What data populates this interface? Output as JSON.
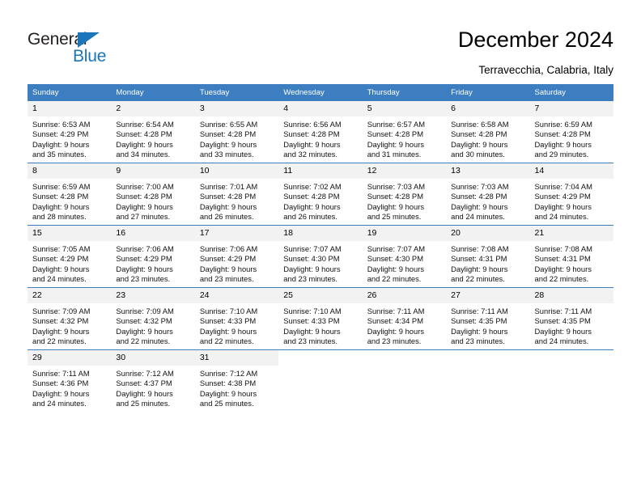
{
  "brand": {
    "name_part1": "General",
    "name_part2": "Blue",
    "accent_color": "#1b75bb"
  },
  "header": {
    "title": "December 2024",
    "subtitle": "Terravecchia, Calabria, Italy",
    "header_bg_color": "#3c7ebf",
    "daynum_bg_color": "#f2f2f2"
  },
  "weekdays": [
    "Sunday",
    "Monday",
    "Tuesday",
    "Wednesday",
    "Thursday",
    "Friday",
    "Saturday"
  ],
  "weeks": [
    [
      {
        "day": "1",
        "sunrise": "Sunrise: 6:53 AM",
        "sunset": "Sunset: 4:29 PM",
        "daylight1": "Daylight: 9 hours",
        "daylight2": "and 35 minutes."
      },
      {
        "day": "2",
        "sunrise": "Sunrise: 6:54 AM",
        "sunset": "Sunset: 4:28 PM",
        "daylight1": "Daylight: 9 hours",
        "daylight2": "and 34 minutes."
      },
      {
        "day": "3",
        "sunrise": "Sunrise: 6:55 AM",
        "sunset": "Sunset: 4:28 PM",
        "daylight1": "Daylight: 9 hours",
        "daylight2": "and 33 minutes."
      },
      {
        "day": "4",
        "sunrise": "Sunrise: 6:56 AM",
        "sunset": "Sunset: 4:28 PM",
        "daylight1": "Daylight: 9 hours",
        "daylight2": "and 32 minutes."
      },
      {
        "day": "5",
        "sunrise": "Sunrise: 6:57 AM",
        "sunset": "Sunset: 4:28 PM",
        "daylight1": "Daylight: 9 hours",
        "daylight2": "and 31 minutes."
      },
      {
        "day": "6",
        "sunrise": "Sunrise: 6:58 AM",
        "sunset": "Sunset: 4:28 PM",
        "daylight1": "Daylight: 9 hours",
        "daylight2": "and 30 minutes."
      },
      {
        "day": "7",
        "sunrise": "Sunrise: 6:59 AM",
        "sunset": "Sunset: 4:28 PM",
        "daylight1": "Daylight: 9 hours",
        "daylight2": "and 29 minutes."
      }
    ],
    [
      {
        "day": "8",
        "sunrise": "Sunrise: 6:59 AM",
        "sunset": "Sunset: 4:28 PM",
        "daylight1": "Daylight: 9 hours",
        "daylight2": "and 28 minutes."
      },
      {
        "day": "9",
        "sunrise": "Sunrise: 7:00 AM",
        "sunset": "Sunset: 4:28 PM",
        "daylight1": "Daylight: 9 hours",
        "daylight2": "and 27 minutes."
      },
      {
        "day": "10",
        "sunrise": "Sunrise: 7:01 AM",
        "sunset": "Sunset: 4:28 PM",
        "daylight1": "Daylight: 9 hours",
        "daylight2": "and 26 minutes."
      },
      {
        "day": "11",
        "sunrise": "Sunrise: 7:02 AM",
        "sunset": "Sunset: 4:28 PM",
        "daylight1": "Daylight: 9 hours",
        "daylight2": "and 26 minutes."
      },
      {
        "day": "12",
        "sunrise": "Sunrise: 7:03 AM",
        "sunset": "Sunset: 4:28 PM",
        "daylight1": "Daylight: 9 hours",
        "daylight2": "and 25 minutes."
      },
      {
        "day": "13",
        "sunrise": "Sunrise: 7:03 AM",
        "sunset": "Sunset: 4:28 PM",
        "daylight1": "Daylight: 9 hours",
        "daylight2": "and 24 minutes."
      },
      {
        "day": "14",
        "sunrise": "Sunrise: 7:04 AM",
        "sunset": "Sunset: 4:29 PM",
        "daylight1": "Daylight: 9 hours",
        "daylight2": "and 24 minutes."
      }
    ],
    [
      {
        "day": "15",
        "sunrise": "Sunrise: 7:05 AM",
        "sunset": "Sunset: 4:29 PM",
        "daylight1": "Daylight: 9 hours",
        "daylight2": "and 24 minutes."
      },
      {
        "day": "16",
        "sunrise": "Sunrise: 7:06 AM",
        "sunset": "Sunset: 4:29 PM",
        "daylight1": "Daylight: 9 hours",
        "daylight2": "and 23 minutes."
      },
      {
        "day": "17",
        "sunrise": "Sunrise: 7:06 AM",
        "sunset": "Sunset: 4:29 PM",
        "daylight1": "Daylight: 9 hours",
        "daylight2": "and 23 minutes."
      },
      {
        "day": "18",
        "sunrise": "Sunrise: 7:07 AM",
        "sunset": "Sunset: 4:30 PM",
        "daylight1": "Daylight: 9 hours",
        "daylight2": "and 23 minutes."
      },
      {
        "day": "19",
        "sunrise": "Sunrise: 7:07 AM",
        "sunset": "Sunset: 4:30 PM",
        "daylight1": "Daylight: 9 hours",
        "daylight2": "and 22 minutes."
      },
      {
        "day": "20",
        "sunrise": "Sunrise: 7:08 AM",
        "sunset": "Sunset: 4:31 PM",
        "daylight1": "Daylight: 9 hours",
        "daylight2": "and 22 minutes."
      },
      {
        "day": "21",
        "sunrise": "Sunrise: 7:08 AM",
        "sunset": "Sunset: 4:31 PM",
        "daylight1": "Daylight: 9 hours",
        "daylight2": "and 22 minutes."
      }
    ],
    [
      {
        "day": "22",
        "sunrise": "Sunrise: 7:09 AM",
        "sunset": "Sunset: 4:32 PM",
        "daylight1": "Daylight: 9 hours",
        "daylight2": "and 22 minutes."
      },
      {
        "day": "23",
        "sunrise": "Sunrise: 7:09 AM",
        "sunset": "Sunset: 4:32 PM",
        "daylight1": "Daylight: 9 hours",
        "daylight2": "and 22 minutes."
      },
      {
        "day": "24",
        "sunrise": "Sunrise: 7:10 AM",
        "sunset": "Sunset: 4:33 PM",
        "daylight1": "Daylight: 9 hours",
        "daylight2": "and 22 minutes."
      },
      {
        "day": "25",
        "sunrise": "Sunrise: 7:10 AM",
        "sunset": "Sunset: 4:33 PM",
        "daylight1": "Daylight: 9 hours",
        "daylight2": "and 23 minutes."
      },
      {
        "day": "26",
        "sunrise": "Sunrise: 7:11 AM",
        "sunset": "Sunset: 4:34 PM",
        "daylight1": "Daylight: 9 hours",
        "daylight2": "and 23 minutes."
      },
      {
        "day": "27",
        "sunrise": "Sunrise: 7:11 AM",
        "sunset": "Sunset: 4:35 PM",
        "daylight1": "Daylight: 9 hours",
        "daylight2": "and 23 minutes."
      },
      {
        "day": "28",
        "sunrise": "Sunrise: 7:11 AM",
        "sunset": "Sunset: 4:35 PM",
        "daylight1": "Daylight: 9 hours",
        "daylight2": "and 24 minutes."
      }
    ],
    [
      {
        "day": "29",
        "sunrise": "Sunrise: 7:11 AM",
        "sunset": "Sunset: 4:36 PM",
        "daylight1": "Daylight: 9 hours",
        "daylight2": "and 24 minutes."
      },
      {
        "day": "30",
        "sunrise": "Sunrise: 7:12 AM",
        "sunset": "Sunset: 4:37 PM",
        "daylight1": "Daylight: 9 hours",
        "daylight2": "and 25 minutes."
      },
      {
        "day": "31",
        "sunrise": "Sunrise: 7:12 AM",
        "sunset": "Sunset: 4:38 PM",
        "daylight1": "Daylight: 9 hours",
        "daylight2": "and 25 minutes."
      },
      {
        "day": "",
        "sunrise": "",
        "sunset": "",
        "daylight1": "",
        "daylight2": ""
      },
      {
        "day": "",
        "sunrise": "",
        "sunset": "",
        "daylight1": "",
        "daylight2": ""
      },
      {
        "day": "",
        "sunrise": "",
        "sunset": "",
        "daylight1": "",
        "daylight2": ""
      },
      {
        "day": "",
        "sunrise": "",
        "sunset": "",
        "daylight1": "",
        "daylight2": ""
      }
    ]
  ]
}
